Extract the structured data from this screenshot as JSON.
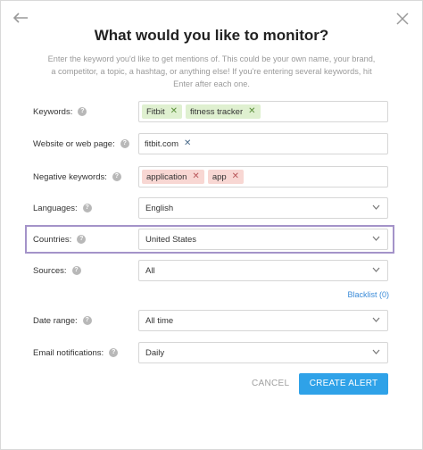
{
  "dialog": {
    "title": "What would you like to monitor?",
    "subtitle": "Enter the keyword you'd like to get mentions of. This could be your own name, your brand, a competitor, a topic, a hashtag, or anything else! If you're entering several keywords, hit Enter after each one."
  },
  "icons": {
    "back": "back-arrow-icon",
    "close": "close-icon",
    "help": "question-mark-icon",
    "remove": "x-icon",
    "dropdown": "chevron-down-icon"
  },
  "colors": {
    "accent": "#2fa2e8",
    "chip_green": "#dff0d0",
    "chip_red": "#f8d7d3",
    "highlight": "#a493c9",
    "link": "#3a8bd8"
  },
  "fields": {
    "keywords": {
      "label": "Keywords:",
      "chips": [
        "Fitbit",
        "fitness tracker"
      ]
    },
    "website": {
      "label": "Website or web page:",
      "chips": [
        "fitbit.com"
      ]
    },
    "negative": {
      "label": "Negative keywords:",
      "chips": [
        "application",
        "app"
      ]
    },
    "languages": {
      "label": "Languages:",
      "value": "English"
    },
    "countries": {
      "label": "Countries:",
      "value": "United States"
    },
    "sources": {
      "label": "Sources:",
      "value": "All"
    },
    "date_range": {
      "label": "Date range:",
      "value": "All time"
    },
    "email": {
      "label": "Email notifications:",
      "value": "Daily"
    }
  },
  "blacklist_label": "Blacklist (0)",
  "actions": {
    "cancel": "CANCEL",
    "create": "CREATE ALERT"
  }
}
